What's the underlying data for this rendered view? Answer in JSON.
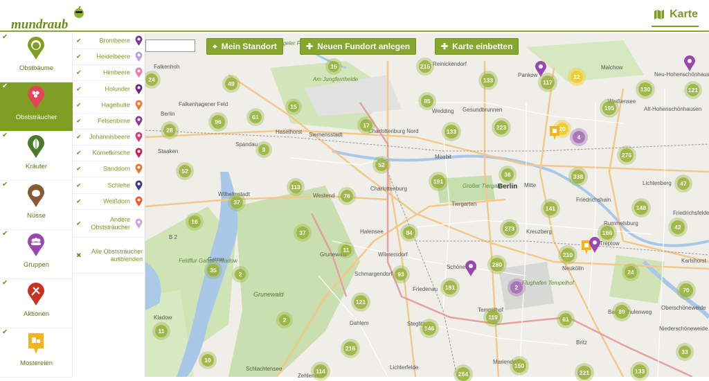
{
  "header": {
    "logo_text": "mundraub",
    "nav_karte": "Karte",
    "colors": {
      "brand": "#7f9e24"
    }
  },
  "toolbar": {
    "search_placeholder": "",
    "buttons": [
      {
        "label": "Mein Standort",
        "icon": "crosshair-icon"
      },
      {
        "label": "Neuen Fundort anlegen",
        "icon": "plus-icon"
      },
      {
        "label": "Karte einbetten",
        "icon": "plus-icon"
      }
    ]
  },
  "sidebar": {
    "categories": [
      {
        "label": "Obstbäume",
        "icon": "apple-icon",
        "color": "#7f9e24",
        "active": false
      },
      {
        "label": "Obststräucher",
        "icon": "raspberry-icon",
        "color": "#e0455c",
        "active": true
      },
      {
        "label": "Kräuter",
        "icon": "leaf-icon",
        "color": "#4a7a2a",
        "active": false
      },
      {
        "label": "Nüsse",
        "icon": "nut-icon",
        "color": "#8a5a32",
        "active": false
      },
      {
        "label": "Gruppen",
        "icon": "group-icon",
        "color": "#9a48b0",
        "active": false
      },
      {
        "label": "Aktionen",
        "icon": "tools-icon",
        "color": "#c8321e",
        "active": false
      },
      {
        "label": "Mostereien",
        "icon": "press-icon",
        "color": "#f2b51e",
        "active": false
      }
    ]
  },
  "subcategories": {
    "items": [
      {
        "label": "Brombeere",
        "color": "#7b3a8e"
      },
      {
        "label": "Heidelbeere",
        "color": "#b9a0e0"
      },
      {
        "label": "Himbeere",
        "color": "#f07aa0"
      },
      {
        "label": "Holunder",
        "color": "#6a2a7a"
      },
      {
        "label": "Hagebutte",
        "color": "#f07a35"
      },
      {
        "label": "Felsenbirne",
        "color": "#8a3a9a"
      },
      {
        "label": "Johannisbeere",
        "color": "#d23c78"
      },
      {
        "label": "Kornelkirsche",
        "color": "#c02a50"
      },
      {
        "label": "Sanddorn",
        "color": "#e8782a"
      },
      {
        "label": "Schlehe",
        "color": "#3a3a8e"
      },
      {
        "label": "Weißdorn",
        "color": "#f05a28"
      },
      {
        "label": "Andere Obststräucher",
        "color": "#c9a8e0"
      }
    ],
    "hide_all": "Alle Obststräucher ausblenden"
  },
  "map": {
    "place_labels": [
      "Falkenhoh",
      "Falkenhagener Feld",
      "Haselhorst",
      "Siemensstadt",
      "Spandau",
      "Staaken",
      "Wilhelmstadt",
      "Westend",
      "Charlottenburg Nord",
      "Charlottenburg",
      "Moabit",
      "Wedding",
      "Gesundbrunnen",
      "Reinickendorf",
      "Pankow",
      "Malchow",
      "Weißensee",
      "Neu-Hohenschönhausen",
      "Alt-Hohenschönhausen",
      "Lichtenberg",
      "Friedrichshain",
      "Berlin",
      "Mitte",
      "Tiergarten",
      "Großer Tiergarten",
      "Kreuzberg",
      "Rummelsburg",
      "Friedrichsfelde",
      "Treptow",
      "Neukölln",
      "Karlshorst",
      "Oberschöneweide",
      "Niederschöneweide",
      "Baumschulenweg",
      "Britz",
      "Tempelhof",
      "Mariendorf",
      "Lichterfelde",
      "Steglitz",
      "Friedenau",
      "Schöneberg",
      "Wilmersdorf",
      "Schmargendorf",
      "Halensee",
      "Dahlem",
      "Grunewald",
      "Gatow",
      "Kladow",
      "Schlachtensee",
      "Zehlendorf",
      "Tegeler Forst",
      "Am Jungfernheide",
      "Flughafen Tempelhof",
      "Feldflur Gatow / Kladow",
      "Berlin",
      "B 2"
    ],
    "clusters": [
      {
        "n": "24",
        "k": "g"
      },
      {
        "n": "49",
        "k": "g"
      },
      {
        "n": "15",
        "k": "g"
      },
      {
        "n": "215",
        "k": "g"
      },
      {
        "n": "133",
        "k": "g"
      },
      {
        "n": "117",
        "k": "g"
      },
      {
        "n": "12",
        "k": "y"
      },
      {
        "n": "130",
        "k": "g"
      },
      {
        "n": "121",
        "k": "g"
      },
      {
        "n": "96",
        "k": "g"
      },
      {
        "n": "61",
        "k": "g"
      },
      {
        "n": "15",
        "k": "g"
      },
      {
        "n": "85",
        "k": "g"
      },
      {
        "n": "195",
        "k": "g"
      },
      {
        "n": "28",
        "k": "g"
      },
      {
        "n": "17",
        "k": "g"
      },
      {
        "n": "133",
        "k": "g"
      },
      {
        "n": "223",
        "k": "g"
      },
      {
        "n": "20",
        "k": "y"
      },
      {
        "n": "4",
        "k": "p"
      },
      {
        "n": "9",
        "k": "g"
      },
      {
        "n": "276",
        "k": "g"
      },
      {
        "n": "52",
        "k": "g"
      },
      {
        "n": "52",
        "k": "g"
      },
      {
        "n": "36",
        "k": "g"
      },
      {
        "n": "338",
        "k": "g"
      },
      {
        "n": "47",
        "k": "g"
      },
      {
        "n": "113",
        "k": "g"
      },
      {
        "n": "191",
        "k": "g"
      },
      {
        "n": "76",
        "k": "g"
      },
      {
        "n": "37",
        "k": "g"
      },
      {
        "n": "141",
        "k": "g"
      },
      {
        "n": "148",
        "k": "g"
      },
      {
        "n": "16",
        "k": "g"
      },
      {
        "n": "37",
        "k": "g"
      },
      {
        "n": "84",
        "k": "g"
      },
      {
        "n": "273",
        "k": "g"
      },
      {
        "n": "166",
        "k": "g"
      },
      {
        "n": "42",
        "k": "g"
      },
      {
        "n": "11",
        "k": "g"
      },
      {
        "n": "210",
        "k": "g"
      },
      {
        "n": "35",
        "k": "g"
      },
      {
        "n": "280",
        "k": "g"
      },
      {
        "n": "2",
        "k": "g"
      },
      {
        "n": "93",
        "k": "g"
      },
      {
        "n": "181",
        "k": "g"
      },
      {
        "n": "2",
        "k": "p"
      },
      {
        "n": "24",
        "k": "g"
      },
      {
        "n": "70",
        "k": "g"
      },
      {
        "n": "121",
        "k": "g"
      },
      {
        "n": "119",
        "k": "g"
      },
      {
        "n": "61",
        "k": "g"
      },
      {
        "n": "89",
        "k": "g"
      },
      {
        "n": "2",
        "k": "g"
      },
      {
        "n": "146",
        "k": "g"
      },
      {
        "n": "11",
        "k": "g"
      },
      {
        "n": "216",
        "k": "g"
      },
      {
        "n": "10",
        "k": "g"
      },
      {
        "n": "114",
        "k": "g"
      },
      {
        "n": "150",
        "k": "g"
      },
      {
        "n": "264",
        "k": "g"
      },
      {
        "n": "221",
        "k": "g"
      },
      {
        "n": "133",
        "k": "g"
      },
      {
        "n": "33",
        "k": "g"
      }
    ]
  }
}
